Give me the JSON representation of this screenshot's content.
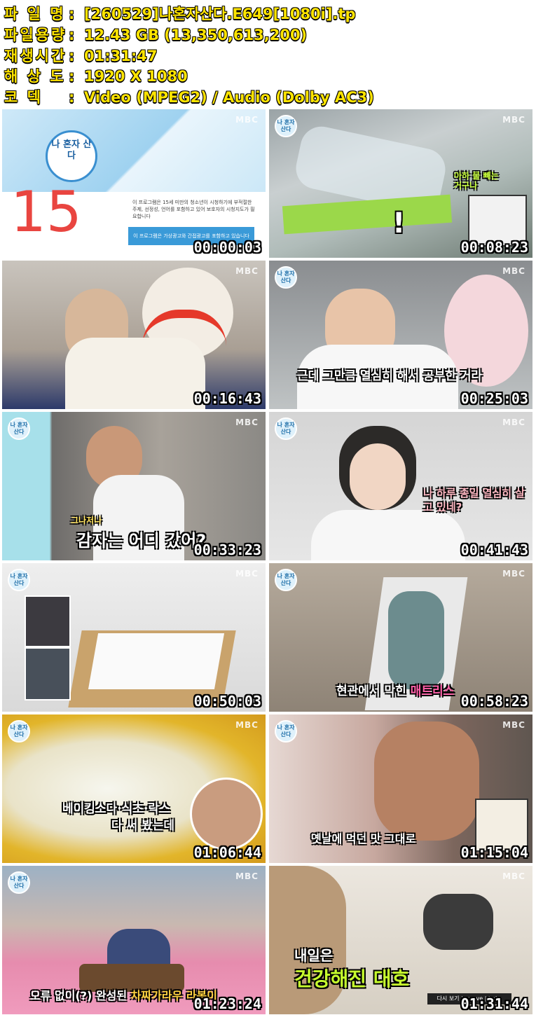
{
  "file_info": [
    {
      "label": "파 일 명",
      "value": "[260529]나혼자산다.E649[1080i].tp"
    },
    {
      "label": "파일용량",
      "value": "12.43 GB (13,350,613,200)"
    },
    {
      "label": "재생시간",
      "value": "01:31:47"
    },
    {
      "label": "해 상 도",
      "value": "1920 X 1080"
    },
    {
      "label": "코    덱",
      "value": "Video (MPEG2) / Audio (Dolby AC3)"
    }
  ],
  "colon": ":",
  "broadcaster": "MBC",
  "show_logo": "나 혼자 산다",
  "thumbnails": [
    {
      "time": "00:00:03",
      "caption": "15",
      "caption2": "이 프로그램은 15세 미만의 청소년이 시청하기에 부적절한 주제, 선정성, 언어를 포함하고 있어 보호자의 시청지도가 필요합니다",
      "caption3": "이 프로그램은 가상광고와 간접광고를 포함하고 있습니다"
    },
    {
      "time": "00:08:23",
      "caption": "아하 물 빼는 거구나",
      "caption2": "!",
      "caption3": ""
    },
    {
      "time": "00:16:43",
      "caption": "",
      "caption2": "",
      "caption3": ""
    },
    {
      "time": "00:25:03",
      "caption": "근데 그만큼 열심히 해서 공부한 거라",
      "caption2": "",
      "caption3": ""
    },
    {
      "time": "00:33:23",
      "caption": "감자는 어디 갔어?",
      "caption2": "그나저나",
      "caption3": ""
    },
    {
      "time": "00:41:43",
      "caption": "나 하루 종일 열심히 살고 있네?",
      "caption2": "",
      "caption3": ""
    },
    {
      "time": "00:50:03",
      "caption": "",
      "caption2": "",
      "caption3": ""
    },
    {
      "time": "00:58:23",
      "caption": "현관에서 막힌 ",
      "caption2": "매트리스",
      "caption3": ""
    },
    {
      "time": "01:06:44",
      "caption": "베이킹소다·식초·락스",
      "caption2": "다 써 봤는데",
      "caption3": ""
    },
    {
      "time": "01:15:04",
      "caption": "옛날에 먹던 맛 그대로",
      "caption2": "",
      "caption3": ""
    },
    {
      "time": "01:23:24",
      "caption": "오류 없이(?) 완성된 ",
      "caption2": "차짜가라우 라볶이",
      "caption3": ""
    },
    {
      "time": "01:31:44",
      "caption": "내일은",
      "caption2": "건강해진 대호",
      "caption3": "다시 보기 | wavve | imbc"
    }
  ]
}
